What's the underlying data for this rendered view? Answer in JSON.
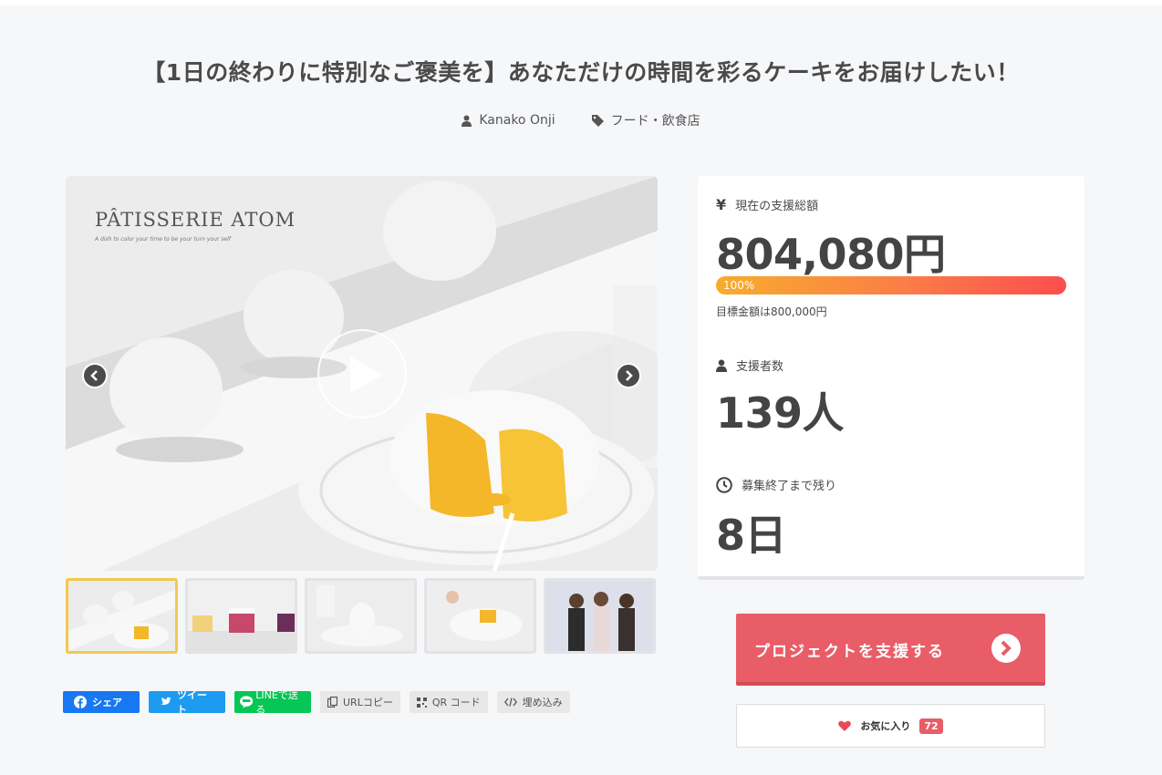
{
  "project": {
    "title": "【1日の終わりに特別なご褒美を】あなただけの時間を彩るケーキをお届けしたい！",
    "author": "Kanako Onji",
    "category": "フード・飲食店"
  },
  "gallery": {
    "brand_name": "PÂTISSERIE ATOM",
    "brand_tagline": "A dish to color your time to be your turn your self",
    "thumbnail_count": 5
  },
  "stats": {
    "total_icon": "yen-icon",
    "total_label": "現在の支援総額",
    "total_value": "804,080円",
    "progress_percent": 100,
    "progress_label": "100%",
    "goal_text": "目標金額は800,000円",
    "backers_label": "支援者数",
    "backers_value": "139人",
    "remaining_label": "募集終了まで残り",
    "remaining_value": "8日"
  },
  "actions": {
    "support_label": "プロジェクトを支援する",
    "favorite_label": "お気に入り",
    "favorite_count": "72"
  },
  "share": {
    "facebook": "シェア",
    "twitter": "ツイート",
    "line": "LINEで送る",
    "url_copy": "URLコピー",
    "qr_code": "QR コード",
    "embed": "埋め込み"
  },
  "colors": {
    "accent": "#e85d67",
    "progress_start": "#f7ad2d",
    "progress_end": "#fc4e4e",
    "facebook": "#1877f2",
    "twitter": "#1d9bf0",
    "line": "#06c755",
    "thumb_active": "#f5c84c"
  }
}
